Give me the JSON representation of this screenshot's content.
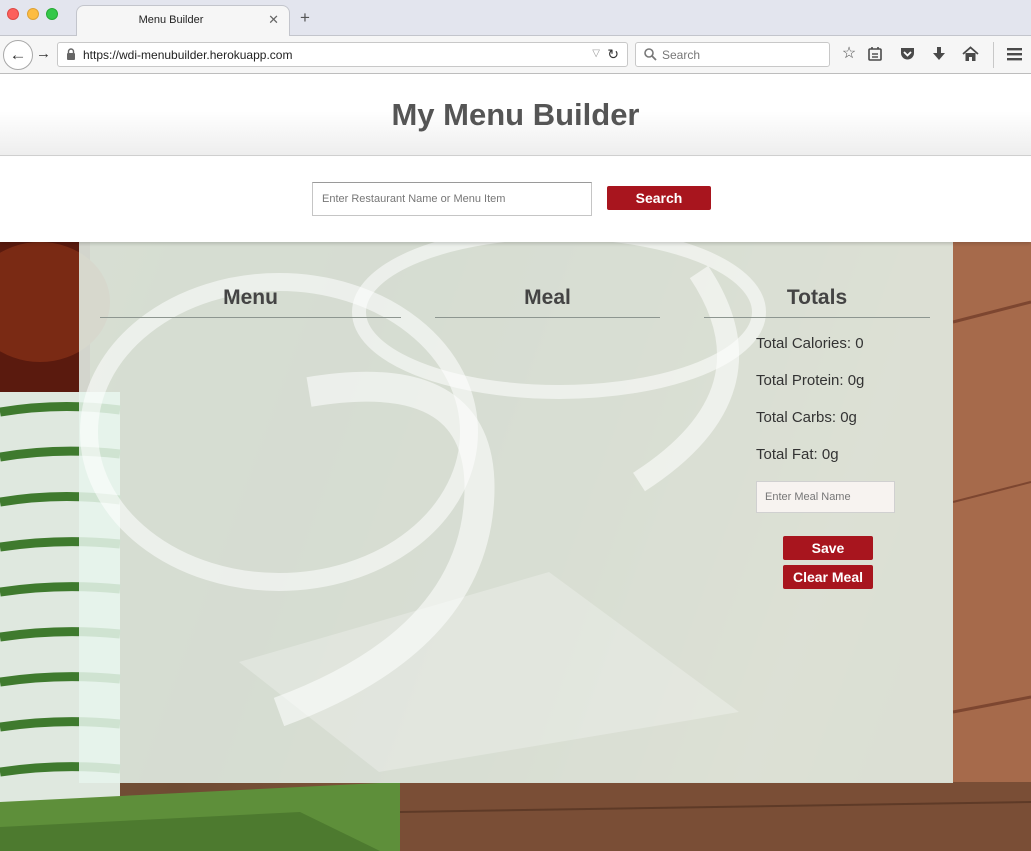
{
  "browser": {
    "tab_title": "Menu Builder",
    "tab_close": "✕",
    "new_tab": "+",
    "url": "https://wdi-menubuilder.herokuapp.com",
    "search_placeholder": "Search",
    "back_glyph": "←",
    "forward_glyph": "→",
    "reload_glyph": "↻",
    "dropdown_glyph": "▽"
  },
  "header": {
    "title": "My Menu Builder"
  },
  "search": {
    "placeholder": "Enter Restaurant Name or Menu Item",
    "value": "",
    "button_label": "Search"
  },
  "columns": {
    "menu_title": "Menu",
    "meal_title": "Meal",
    "totals_title": "Totals"
  },
  "totals": {
    "calories": "Total Calories: 0",
    "protein": "Total Protein: 0g",
    "carbs": "Total Carbs: 0g",
    "fat": "Total Fat: 0g"
  },
  "meal_form": {
    "name_placeholder": "Enter Meal Name",
    "name_value": "",
    "save_label": "Save",
    "clear_label": "Clear Meal"
  },
  "colors": {
    "accent": "#a8151e",
    "title_text": "#555555",
    "panel": "#e6f4ec"
  }
}
